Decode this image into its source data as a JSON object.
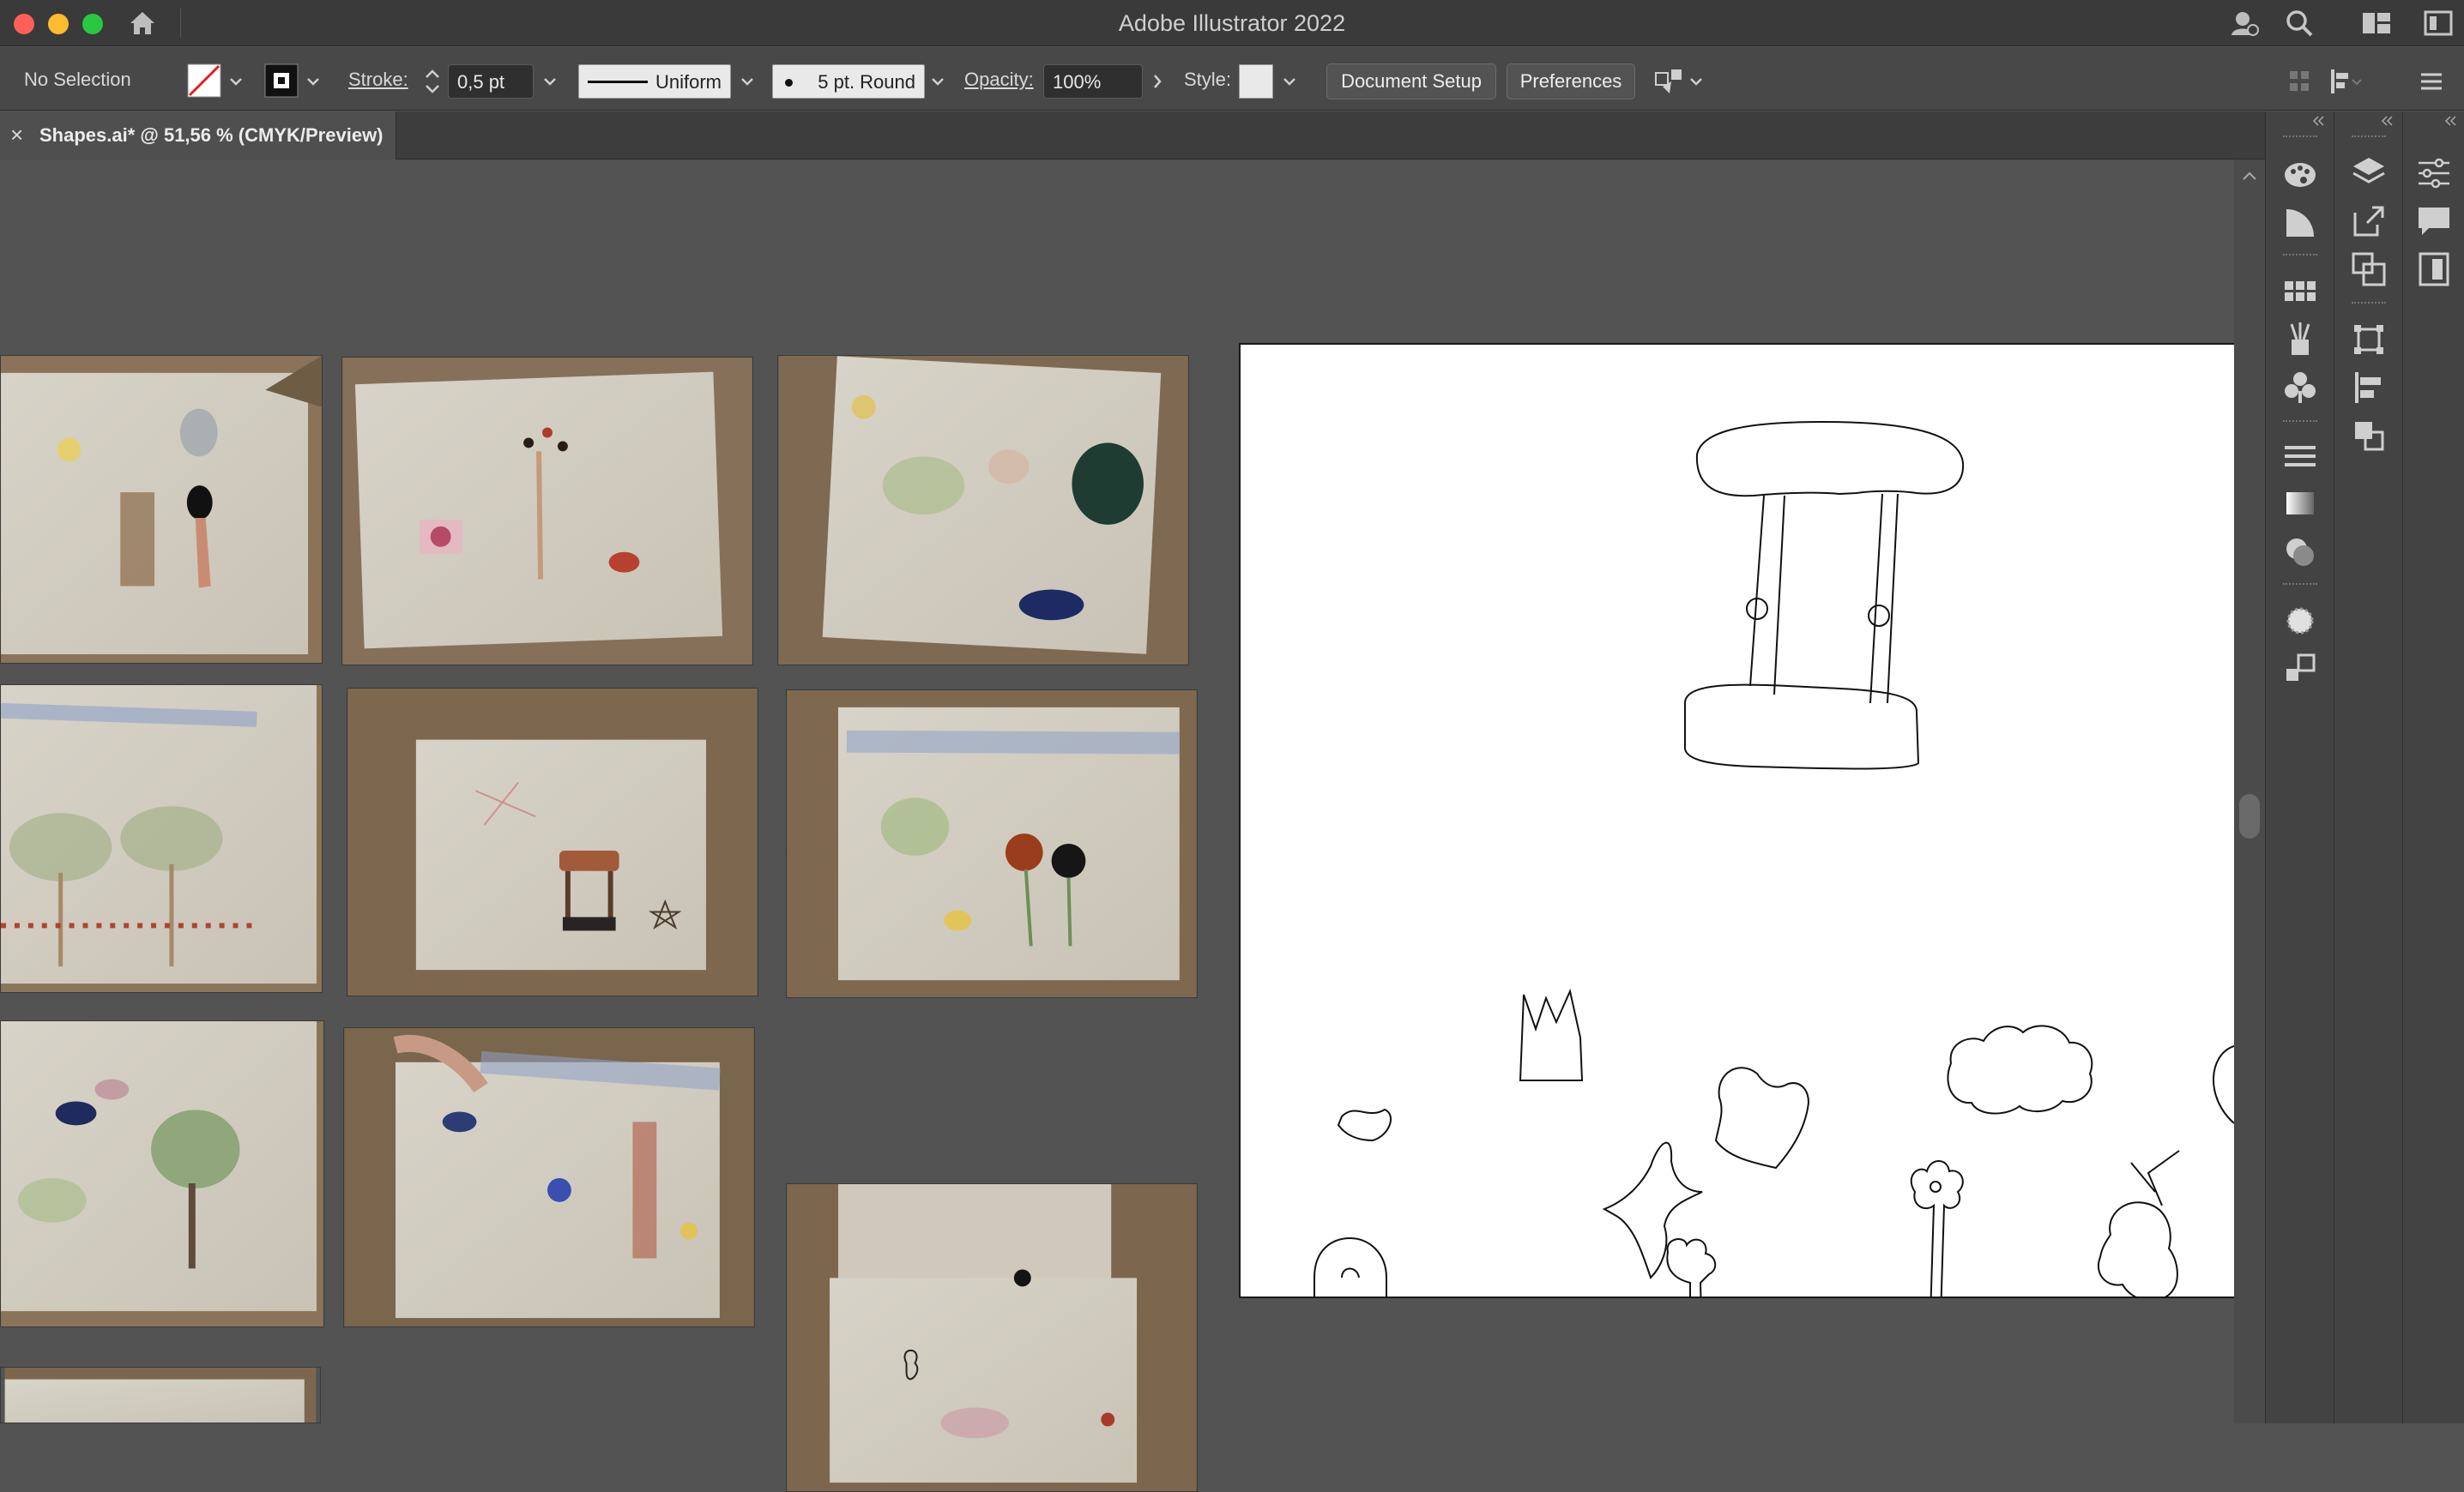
{
  "app": {
    "title": "Adobe Illustrator 2022"
  },
  "window_controls": {
    "close_color": "#ff5f57",
    "minimize_color": "#febc2e",
    "zoom_color": "#28c840"
  },
  "icons": {
    "home": "home-icon",
    "cloud_user": "cloud-user-icon",
    "search": "search-icon",
    "workspace": "workspace-switcher-icon",
    "panel_toggle": "panel-toggle-icon"
  },
  "control_bar": {
    "selection": "No Selection",
    "stroke_label": "Stroke:",
    "stroke_weight": "0,5 pt",
    "stroke_profile": "Uniform",
    "brush": "5 pt. Round",
    "opacity_label": "Opacity:",
    "opacity_value": "100%",
    "style_label": "Style:",
    "document_setup": "Document Setup",
    "preferences": "Preferences"
  },
  "document_tab": {
    "close": "×",
    "label": "Shapes.ai* @ 51,56 % (CMYK/Preview)"
  },
  "placed_photos": {
    "count": 10,
    "subject": "children's drawings in cardboard boxes"
  },
  "artboard": {
    "background": "#ffffff",
    "shapes": [
      "swing",
      "crown",
      "bird",
      "starfish",
      "bird-outline",
      "cloud",
      "flower",
      "butterfly",
      "arch-door",
      "small-tree"
    ]
  },
  "panels": {
    "column1": [
      "color-icon",
      "color-guide-icon",
      "swatches-icon",
      "brushes-icon",
      "symbols-icon",
      "stroke-icon",
      "gradient-icon",
      "transparency-icon",
      "appearance-icon",
      "graphic-styles-icon"
    ],
    "column2": [
      "layers-icon",
      "export-icon",
      "artboards-icon",
      "transform-icon",
      "align-icon",
      "pathfinder-icon"
    ],
    "column3": [
      "properties-icon",
      "comments-icon",
      "libraries-icon"
    ]
  },
  "colors": {
    "accent": "#1473e6",
    "chrome_dark": "#3a3a3a",
    "canvas": "#535353"
  }
}
